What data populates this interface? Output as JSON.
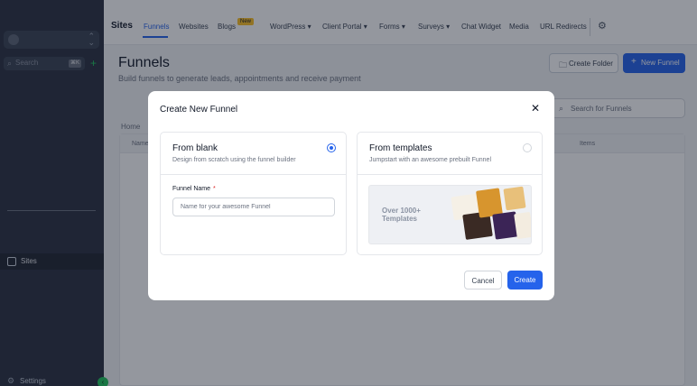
{
  "sidebar": {
    "search_placeholder": "Search",
    "search_shortcut": "⌘K",
    "active_item_label": "Sites",
    "settings_label": "Settings"
  },
  "topnav": {
    "brand": "Sites",
    "items": [
      {
        "label": "Funnels",
        "active": true
      },
      {
        "label": "Websites"
      },
      {
        "label": "Blogs",
        "badge": "New"
      },
      {
        "label": "WordPress ▾"
      },
      {
        "label": "Client Portal ▾"
      },
      {
        "label": "Forms ▾"
      },
      {
        "label": "Surveys ▾"
      },
      {
        "label": "Chat Widget"
      },
      {
        "label": "Media"
      },
      {
        "label": "URL Redirects"
      }
    ]
  },
  "page": {
    "title": "Funnels",
    "subtitle": "Build funnels to generate leads, appointments and receive payment",
    "create_folder_label": "Create Folder",
    "new_funnel_label": "New Funnel",
    "search_placeholder": "Search for Funnels",
    "breadcrumb_home": "Home",
    "table_headers": {
      "name": "Name",
      "items": "Items"
    }
  },
  "modal": {
    "title": "Create New Funnel",
    "blank": {
      "title": "From blank",
      "description": "Design from scratch using the funnel builder",
      "selected": true,
      "field_label": "Funnel Name",
      "field_required_mark": "*",
      "field_placeholder": "Name for your awesome Funnel",
      "field_value": ""
    },
    "templates": {
      "title": "From templates",
      "description": "Jumpstart with an awesome prebuilt Funnel",
      "selected": false,
      "preview_text": "Over 1000+ Templates"
    },
    "cancel_label": "Cancel",
    "create_label": "Create"
  },
  "colors": {
    "accent": "#2563eb",
    "sidebar": "#2a3140",
    "badge": "#fbbf24",
    "success": "#22c55e"
  }
}
